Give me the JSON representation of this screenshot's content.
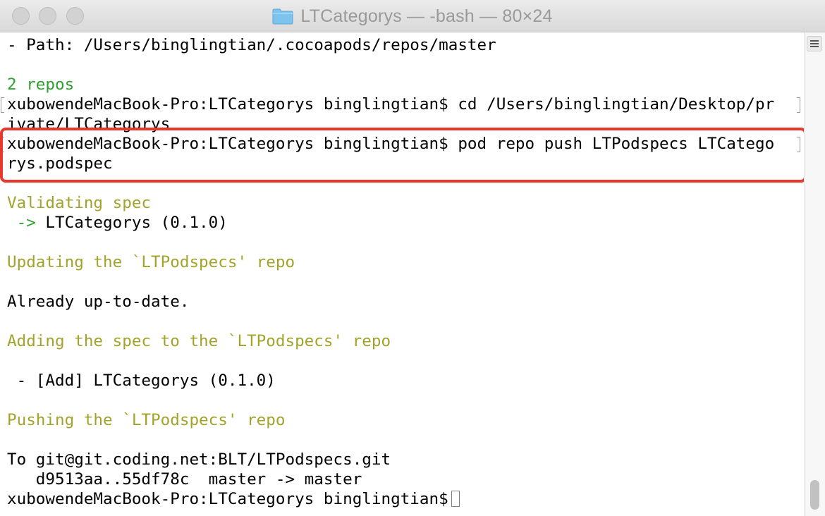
{
  "window": {
    "title": "LTCategorys — -bash — 80×24",
    "folder_icon": "folder-icon"
  },
  "terminal": {
    "lines": [
      "- Path: /Users/binglingtian/.cocoapods/repos/master",
      "2 repos",
      "xubowendeMacBook-Pro:LTCategorys binglingtian$ cd /Users/binglingtian/Desktop/pr",
      "ivate/LTCategorys",
      "xubowendeMacBook-Pro:LTCategorys binglingtian$ pod repo push LTPodspecs LTCatego",
      "rys.podspec",
      "Validating spec",
      " -> ",
      "LTCategorys (0.1.0)",
      "Updating the `LTPodspecs' repo",
      "Already up-to-date.",
      "Adding the spec to the `LTPodspecs' repo",
      " - [Add] LTCategorys (0.1.0)",
      "Pushing the `LTPodspecs' repo",
      "To git@git.coding.net:BLT/LTPodspecs.git",
      "   d9513aa..55df78c  master -> master",
      "xubowendeMacBook-Pro:LTCategorys binglingtian$"
    ]
  },
  "colors": {
    "green": "#2ea02e",
    "olive": "#a3a32c",
    "highlight": "#e8372d"
  }
}
